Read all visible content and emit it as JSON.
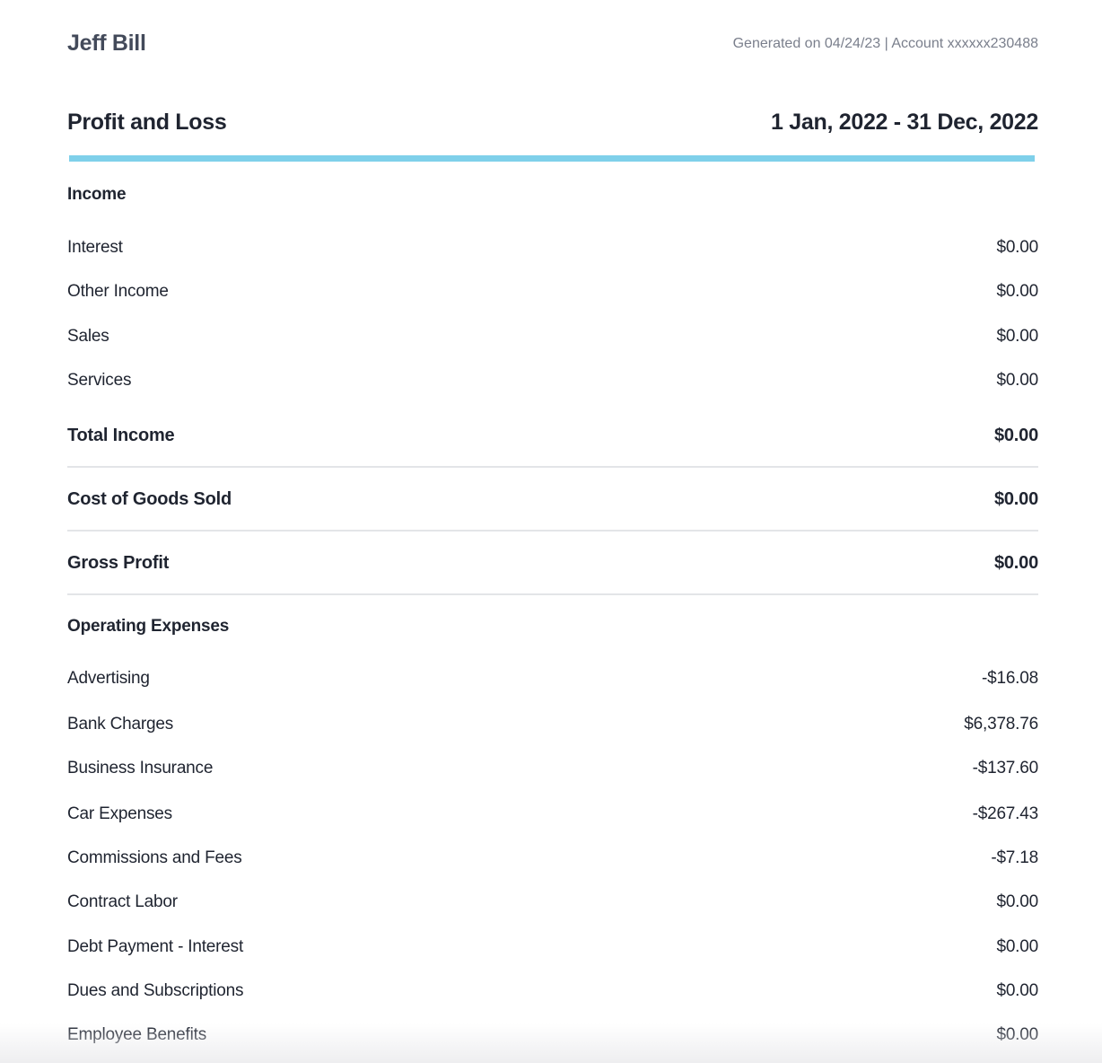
{
  "header": {
    "owner_name": "Jeff Bill",
    "generated_meta": "Generated on 04/24/23 | Account xxxxxx230488"
  },
  "report": {
    "title": "Profit and Loss",
    "period": "1 Jan, 2022 - 31 Dec, 2022"
  },
  "colors": {
    "accent_rule": "#7fd0ea"
  },
  "income": {
    "heading": "Income",
    "items": [
      {
        "label": "Interest",
        "value": "$0.00"
      },
      {
        "label": "Other Income",
        "value": "$0.00"
      },
      {
        "label": "Sales",
        "value": "$0.00"
      },
      {
        "label": "Services",
        "value": "$0.00"
      }
    ],
    "total_label": "Total Income",
    "total_value": "$0.00"
  },
  "cogs": {
    "label": "Cost of Goods Sold",
    "value": "$0.00"
  },
  "gross_profit": {
    "label": "Gross Profit",
    "value": "$0.00"
  },
  "operating_expenses": {
    "heading": "Operating Expenses",
    "items": [
      {
        "label": "Advertising",
        "value": "-$16.08"
      },
      {
        "label": "Bank Charges",
        "value": "$6,378.76"
      },
      {
        "label": "Business Insurance",
        "value": "-$137.60"
      },
      {
        "label": "Car Expenses",
        "value": "-$267.43"
      },
      {
        "label": "Commissions and Fees",
        "value": "-$7.18"
      },
      {
        "label": "Contract Labor",
        "value": "$0.00"
      },
      {
        "label": "Debt Payment - Interest",
        "value": "$0.00"
      },
      {
        "label": "Dues and Subscriptions",
        "value": "$0.00"
      },
      {
        "label": "Employee Benefits",
        "value": "$0.00"
      }
    ]
  }
}
